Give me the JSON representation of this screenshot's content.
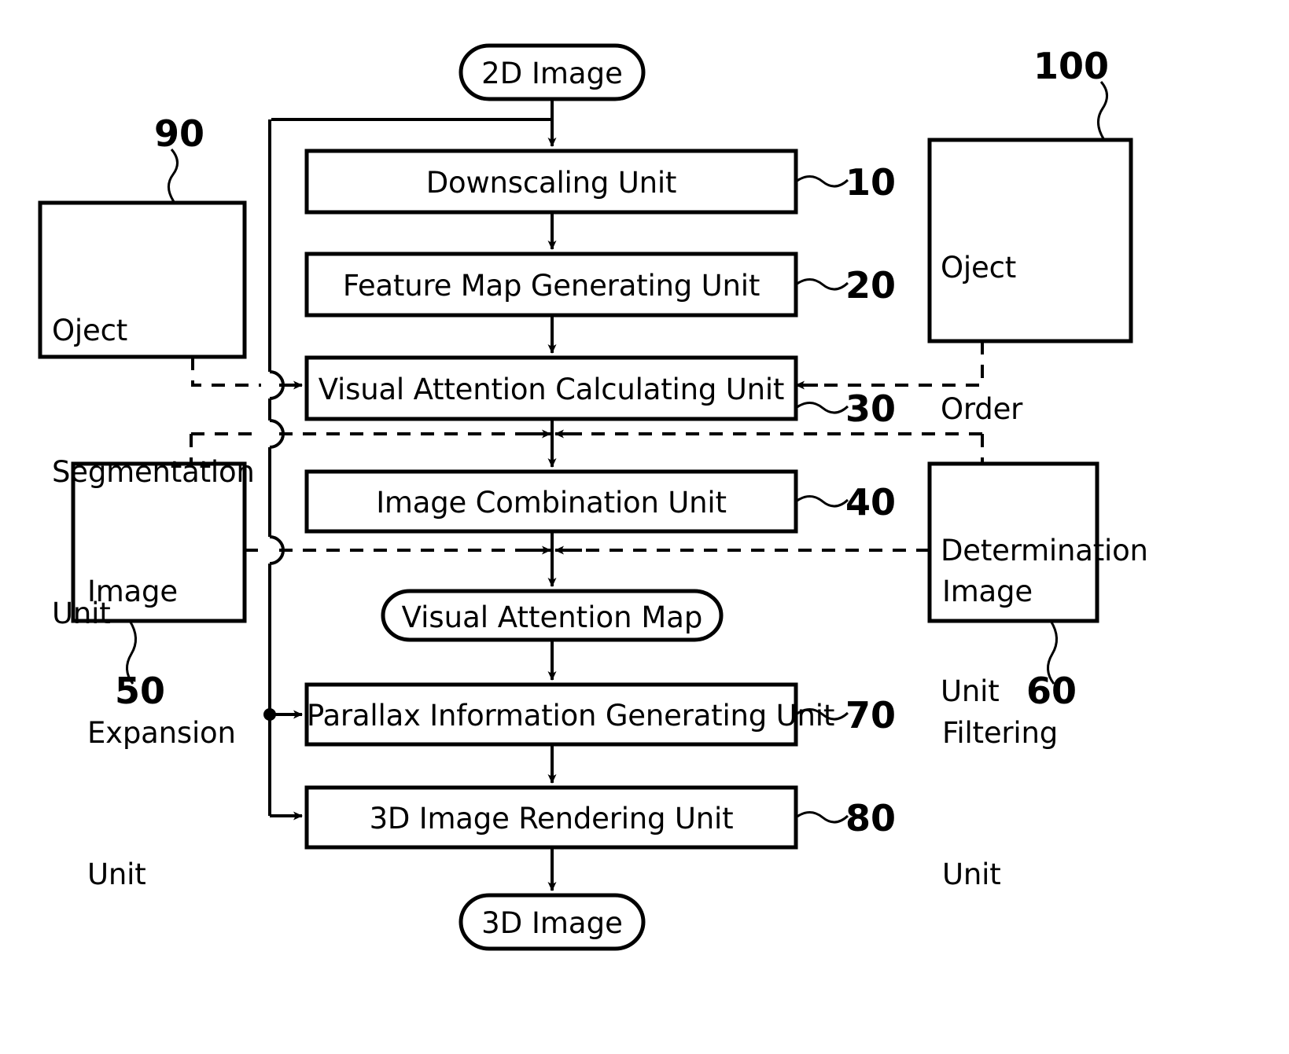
{
  "figure": {
    "title": "2D to 3D image conversion apparatus block diagram",
    "background_color": "#ffffff",
    "line_color": "#000000"
  },
  "terminals": [
    {
      "id": "input-2d-image",
      "label": "2D Image"
    },
    {
      "id": "visual-attention-map",
      "label": "Visual Attention Map"
    },
    {
      "id": "output-3d-image",
      "label": "3D Image"
    }
  ],
  "main_chain": [
    {
      "id": "downscaling-unit",
      "label": "Downscaling Unit",
      "ref": "10"
    },
    {
      "id": "feature-map-generating-unit",
      "label": "Feature Map Generating Unit",
      "ref": "20"
    },
    {
      "id": "visual-attention-calculating-unit",
      "label": "Visual Attention Calculating Unit",
      "ref": "30"
    },
    {
      "id": "image-combination-unit",
      "label": "Image Combination Unit",
      "ref": "40"
    },
    {
      "id": "parallax-information-generating-unit",
      "label": "Parallax Information Generating Unit",
      "ref": "70"
    },
    {
      "id": "3d-image-rendering-unit",
      "label": "3D Image Rendering Unit",
      "ref": "80"
    }
  ],
  "side_units": [
    {
      "id": "oject-segmentation-unit",
      "lines": [
        "Oject",
        "Segmentation",
        "Unit"
      ],
      "ref": "90",
      "side": "left"
    },
    {
      "id": "image-expansion-unit",
      "lines": [
        "Image",
        "Expansion",
        "Unit"
      ],
      "ref": "50",
      "side": "left"
    },
    {
      "id": "oject-order-determination-unit",
      "lines": [
        "Oject",
        "Order",
        "Determination",
        "Unit"
      ],
      "ref": "100",
      "side": "right"
    },
    {
      "id": "image-filtering-unit",
      "lines": [
        "Image",
        "Filtering",
        "Unit"
      ],
      "ref": "60",
      "side": "right"
    }
  ],
  "reference_numerals": {
    "downscaling": "10",
    "feature_map": "20",
    "visual_attention_calculating": "30",
    "image_combination": "40",
    "image_expansion": "50",
    "image_filtering": "60",
    "parallax_information": "70",
    "rendering": "80",
    "oject_segmentation": "90",
    "oject_order_determination": "100"
  }
}
